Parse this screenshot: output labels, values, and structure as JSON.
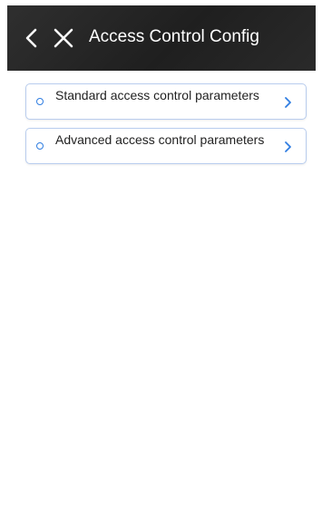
{
  "header": {
    "title": "Access Control Config",
    "back_icon": "chevron-left-icon",
    "close_icon": "close-icon",
    "background": "#262626"
  },
  "list": {
    "items": [
      {
        "label": "Standard access control parameters",
        "icon": "circle-icon",
        "chevron": "chevron-right-icon"
      },
      {
        "label": "Advanced access control parameters",
        "icon": "circle-icon",
        "chevron": "chevron-right-icon"
      }
    ]
  },
  "colors": {
    "accent": "#2f7de1",
    "item_border": "#b9cdee"
  }
}
